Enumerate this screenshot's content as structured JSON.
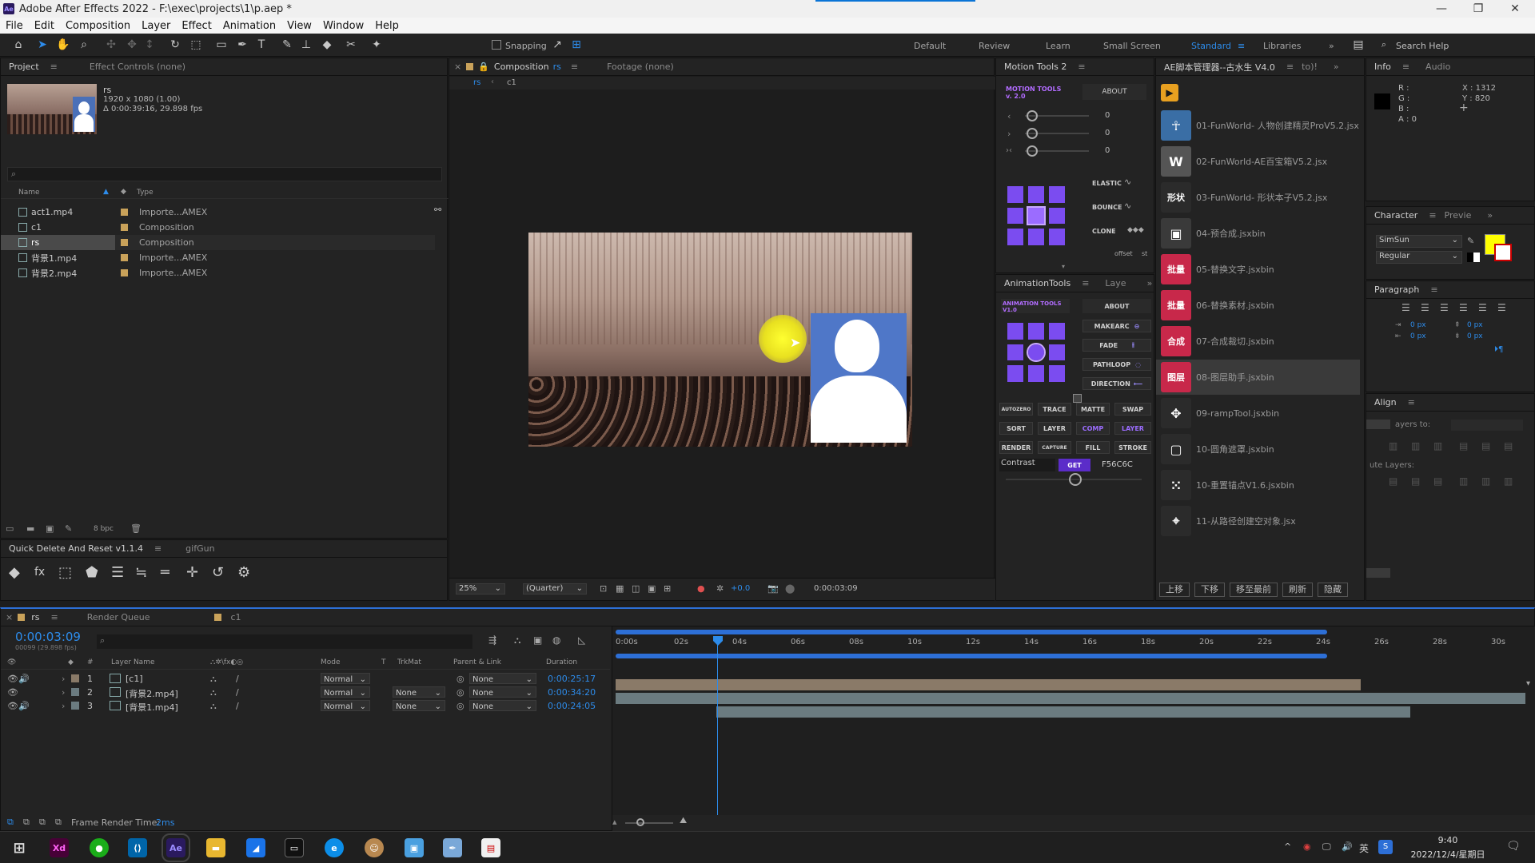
{
  "window": {
    "title": "Adobe After Effects 2022 - F:\\exec\\projects\\1\\p.aep *",
    "logo": "Ae",
    "controls": [
      "minimize-icon",
      "restore-icon",
      "close-icon"
    ]
  },
  "menu": [
    "File",
    "Edit",
    "Composition",
    "Layer",
    "Effect",
    "Animation",
    "View",
    "Window",
    "Help"
  ],
  "toolbar": {
    "snapping_label": "Snapping",
    "workspaces": [
      "Default",
      "Review",
      "Learn",
      "Small Screen",
      "Standard",
      "Libraries"
    ],
    "active_workspace": "Standard",
    "search_placeholder": "Search Help"
  },
  "project_panel": {
    "tab_project": "Project",
    "tab_effect_controls": "Effect Controls (none)",
    "preview_name": "rs",
    "preview_size": "1920 x 1080 (1.00)",
    "preview_duration": "Δ 0:00:39:16, 29.898 fps",
    "col_name": "Name",
    "col_type": "Type",
    "items": [
      {
        "name": "act1.mp4",
        "type": "Importe...AMEX",
        "color": "#c9a25a"
      },
      {
        "name": "c1",
        "type": "Composition",
        "color": "#c9a25a"
      },
      {
        "name": "rs",
        "type": "Composition",
        "color": "#c9a25a"
      },
      {
        "name": "背景1.mp4",
        "type": "Importe...AMEX",
        "color": "#c9a25a"
      },
      {
        "name": "背景2.mp4",
        "type": "Importe...AMEX",
        "color": "#c9a25a"
      }
    ],
    "bpc": "8 bpc"
  },
  "quick_panel": {
    "tab1": "Quick Delete And Reset v1.1.4",
    "tab2": "gifGun"
  },
  "comp_panel": {
    "tab_composition": "Composition",
    "tab_comp_name": "rs",
    "tab_footage": "Footage (none)",
    "breadcrumb": [
      "rs",
      "c1"
    ],
    "zoom": "25%",
    "resolution": "(Quarter)",
    "exposure": "+0.0",
    "timecode": "0:00:03:09"
  },
  "motion_tools": {
    "tab": "Motion Tools 2",
    "brand": "MOTION TOOLS v. 2.0",
    "about": "ABOUT",
    "sliders": [
      "0",
      "0",
      "0"
    ],
    "labels": [
      "ELASTIC",
      "BOUNCE",
      "CLONE"
    ],
    "offset": "offset",
    "step": "st"
  },
  "animation_tools": {
    "tab": "AnimationTools",
    "tab2": "Laye",
    "brand": "ANIMATION TOOLS V1.0",
    "about": "ABOUT",
    "side_buttons": [
      "MAKEARC",
      "FADE",
      "PATHLOOP",
      "DIRECTION"
    ],
    "row1": [
      "AUTOZERO",
      "TRACE",
      "MATTE",
      "SWAP"
    ],
    "row2": [
      "SORT",
      "LAYER",
      "COMP",
      "LAYER"
    ],
    "row3": [
      "RENDER",
      "CAPTURE",
      "FILL",
      "STROKE"
    ],
    "contrast_label": "Contrast",
    "get_label": "GET",
    "hex": "F56C6C"
  },
  "script_manager": {
    "tab": "AE脚本管理器--古水生 V4.0",
    "tab2": "to)!",
    "items": [
      {
        "label": "01-FunWorld- 人物创建精灵ProV5.2.jsx",
        "icon": "figure-icon",
        "color": "#3a6ea5",
        "glyph": "☥"
      },
      {
        "label": "02-FunWorld-AE百宝箱V5.2.jsx",
        "icon": "w-badge-icon",
        "color": "#555555",
        "glyph": "W"
      },
      {
        "label": "03-FunWorld- 形状本子V5.2.jsx",
        "icon": "shape-text-icon",
        "color": "#2b2b2b",
        "glyph": "形状"
      },
      {
        "label": "04-预合成.jsxbin",
        "icon": "precomp-icon",
        "color": "#3a3a3a",
        "glyph": "▣"
      },
      {
        "label": "05-替换文字.jsxbin",
        "icon": "replace-text-icon",
        "color": "#c8284a",
        "glyph": "批量"
      },
      {
        "label": "06-替换素材.jsxbin",
        "icon": "replace-footage-icon",
        "color": "#c8284a",
        "glyph": "批量"
      },
      {
        "label": "07-合成裁切.jsxbin",
        "icon": "comp-crop-icon",
        "color": "#c8284a",
        "glyph": "合成"
      },
      {
        "label": "08-图层助手.jsxbin",
        "icon": "layer-helper-icon",
        "color": "#c8284a",
        "glyph": "图层"
      },
      {
        "label": "09-rampTool.jsxbin",
        "icon": "ramp-arrows-icon",
        "color": "#2b2b2b",
        "glyph": "✥"
      },
      {
        "label": "10-圆角遮罩.jsxbin",
        "icon": "round-mask-icon",
        "color": "#2b2b2b",
        "glyph": "▢"
      },
      {
        "label": "10-重置锚点V1.6.jsxbin",
        "icon": "anchor-grid-icon",
        "color": "#2b2b2b",
        "glyph": "⁙"
      },
      {
        "label": "11-从路径创建空对象.jsx",
        "icon": "null-path-icon",
        "color": "#2b2b2b",
        "glyph": "⌖"
      }
    ],
    "buttons": [
      "上移",
      "下移",
      "移至最前",
      "刷新",
      "隐藏"
    ]
  },
  "info_panel": {
    "tab": "Info",
    "tab2": "Audio",
    "r": "R :",
    "g": "G :",
    "b": "B :",
    "a": "A : 0",
    "x": "X : 1312",
    "y": "Y : 820"
  },
  "character_panel": {
    "tab": "Character",
    "tab2": "Previe",
    "font": "SimSun",
    "style": "Regular",
    "fill_color": "#ffff00"
  },
  "paragraph_panel": {
    "tab": "Paragraph",
    "px1": "0 px",
    "px2": "0 px",
    "px3": "0 px",
    "px4": "0 px"
  },
  "align_panel": {
    "tab": "Align",
    "layers_to": "ayers to:",
    "distribute": "ute Layers:"
  },
  "timeline": {
    "tab_comp": "rs",
    "tab_render": "Render Queue",
    "tab_c1": "c1",
    "timecode": "0:00:03:09",
    "frames": "00099 (29.898 fps)",
    "col_layer_name": "Layer Name",
    "col_mode": "Mode",
    "col_t": "T",
    "col_trkmat": "TrkMat",
    "col_parent": "Parent & Link",
    "col_duration": "Duration",
    "ruler": [
      "0:00s",
      "02s",
      "04s",
      "06s",
      "08s",
      "10s",
      "12s",
      "14s",
      "16s",
      "18s",
      "20s",
      "22s",
      "24s",
      "26s",
      "28s",
      "30s"
    ],
    "layers": [
      {
        "num": "1",
        "name": "[c1]",
        "mode": "Normal",
        "trkmat": "",
        "parent": "None",
        "duration": "0:00:25:17",
        "color": "#8a7a68"
      },
      {
        "num": "2",
        "name": "[背景2.mp4]",
        "mode": "Normal",
        "trkmat": "None",
        "parent": "None",
        "duration": "0:00:34:20",
        "color": "#6b7b80"
      },
      {
        "num": "3",
        "name": "[背景1.mp4]",
        "mode": "Normal",
        "trkmat": "None",
        "parent": "None",
        "duration": "0:00:24:05",
        "color": "#6b7b80"
      }
    ],
    "frame_render_label": "Frame Render Time:",
    "frame_render_value": "2ms"
  },
  "taskbar": {
    "apps": [
      "start-icon",
      "xd-icon",
      "wechat-icon",
      "vscode-icon",
      "ae-icon",
      "explorer-icon",
      "app-icon",
      "terminal-icon",
      "edge-icon",
      "avatar-app-icon",
      "window-app-icon",
      "feather-icon",
      "doc-icon"
    ],
    "time": "9:40",
    "date": "2022/12/4/星期日",
    "ime": "英"
  }
}
